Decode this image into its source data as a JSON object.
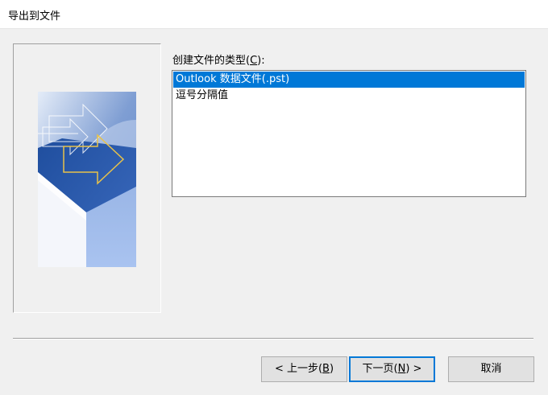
{
  "window": {
    "title": "导出到文件"
  },
  "file_type": {
    "label_prefix": "创建文件的类型(",
    "label_access_key": "C",
    "label_suffix": "):",
    "options": [
      {
        "label": "Outlook 数据文件(.pst)",
        "selected": true
      },
      {
        "label": "逗号分隔值",
        "selected": false
      }
    ]
  },
  "buttons": {
    "back": {
      "prefix": "< 上一步(",
      "key": "B",
      "suffix": ")"
    },
    "next": {
      "prefix": "下一页(",
      "key": "N",
      "suffix": ") >"
    },
    "cancel": {
      "label": "取消"
    }
  },
  "colors": {
    "selection": "#0078d7",
    "dialog_bg": "#f0f0f0",
    "accent": "#0078d7"
  }
}
